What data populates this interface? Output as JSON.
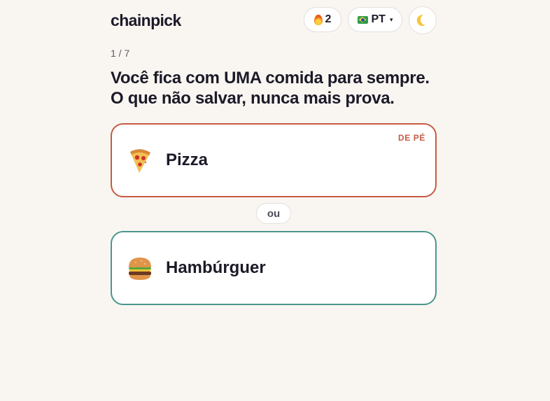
{
  "header": {
    "logo": "chainpick",
    "streak": {
      "icon": "fire-icon",
      "count": "2"
    },
    "language": {
      "icon": "brazil-flag-icon",
      "code": "PT",
      "caret": "▾"
    },
    "theme_toggle": {
      "icon": "moon-icon"
    }
  },
  "progress": "1 / 7",
  "question": {
    "line1": "Você fica com UMA comida para sempre.",
    "line2": "O que não salvar, nunca mais prova."
  },
  "options": [
    {
      "icon": "pizza-icon",
      "label": "Pizza",
      "tag": "DE PÉ",
      "border_color": "#c75a43"
    },
    {
      "icon": "hamburger-icon",
      "label": "Hambúrguer",
      "tag": "",
      "border_color": "#4b968b"
    }
  ],
  "separator": "ou",
  "colors": {
    "background": "#f9f6f2",
    "text": "#1c1a28",
    "accent_red": "#c75a43",
    "accent_teal": "#4b968b"
  }
}
